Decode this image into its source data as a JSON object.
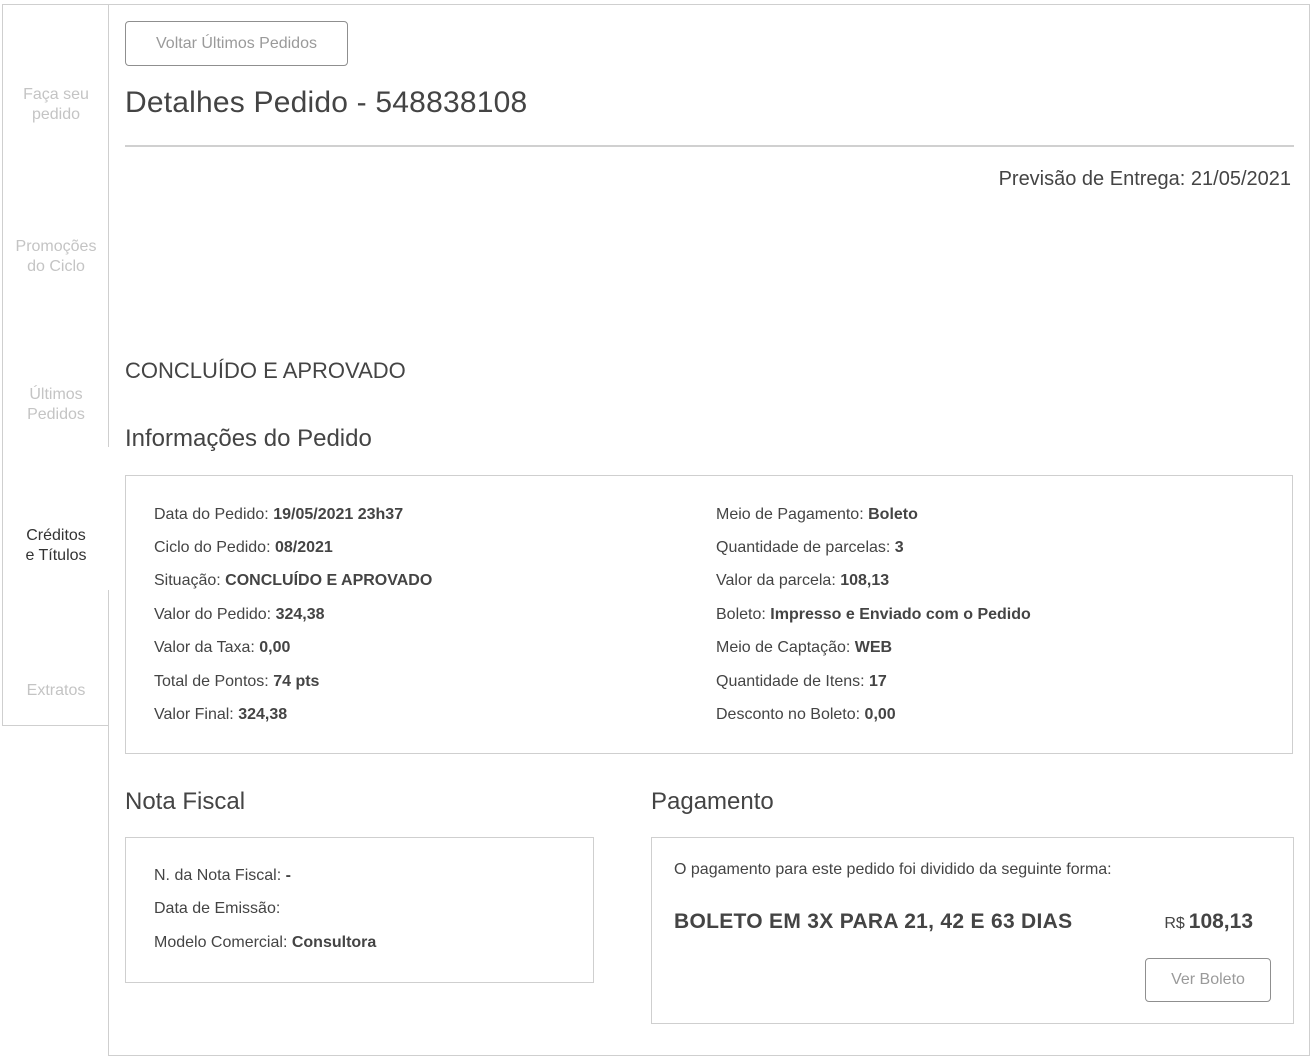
{
  "sidebar": {
    "items": [
      {
        "line1": "Faça seu",
        "line2": "pedido"
      },
      {
        "line1": "Promoções",
        "line2": "do Ciclo"
      },
      {
        "line1": "Últimos",
        "line2": "Pedidos"
      },
      {
        "line1": "Créditos",
        "line2": "e Títulos"
      },
      {
        "line1": "Extratos",
        "line2": ""
      }
    ]
  },
  "header": {
    "back_button": "Voltar Últimos Pedidos",
    "title": "Detalhes Pedido - 548838108",
    "delivery_forecast": "Previsão de Entrega: 21/05/2021"
  },
  "status": "CONCLUÍDO E APROVADO",
  "order_info": {
    "title": "Informações do Pedido",
    "left": [
      {
        "label": "Data do Pedido:",
        "value": "19/05/2021 23h37"
      },
      {
        "label": "Ciclo do Pedido:",
        "value": "08/2021"
      },
      {
        "label": "Situação:",
        "value": "CONCLUÍDO E APROVADO"
      },
      {
        "label": "Valor do Pedido:",
        "value": "324,38"
      },
      {
        "label": "Valor da Taxa:",
        "value": "0,00"
      },
      {
        "label": "Total de Pontos:",
        "value": "74 pts"
      },
      {
        "label": "Valor Final:",
        "value": "324,38"
      }
    ],
    "right": [
      {
        "label": "Meio de Pagamento:",
        "value": "Boleto"
      },
      {
        "label": "Quantidade de parcelas:",
        "value": "3"
      },
      {
        "label": "Valor da parcela:",
        "value": "108,13"
      },
      {
        "label": "Boleto:",
        "value": "Impresso e Enviado com o Pedido"
      },
      {
        "label": "Meio de Captação:",
        "value": "WEB"
      },
      {
        "label": "Quantidade de Itens:",
        "value": "17"
      },
      {
        "label": "Desconto no Boleto:",
        "value": "0,00"
      }
    ]
  },
  "invoice": {
    "title": "Nota Fiscal",
    "rows": [
      {
        "label": "N. da Nota Fiscal:",
        "value": "-"
      },
      {
        "label": "Data de Emissão:",
        "value": ""
      },
      {
        "label": "Modelo Comercial:",
        "value": "Consultora"
      }
    ]
  },
  "payment": {
    "title": "Pagamento",
    "description": "O pagamento para este pedido foi dividido da seguinte forma:",
    "method": "BOLETO EM 3X PARA 21, 42 E 63 DIAS",
    "currency": "R$",
    "amount": "108,13",
    "button": "Ver Boleto"
  }
}
